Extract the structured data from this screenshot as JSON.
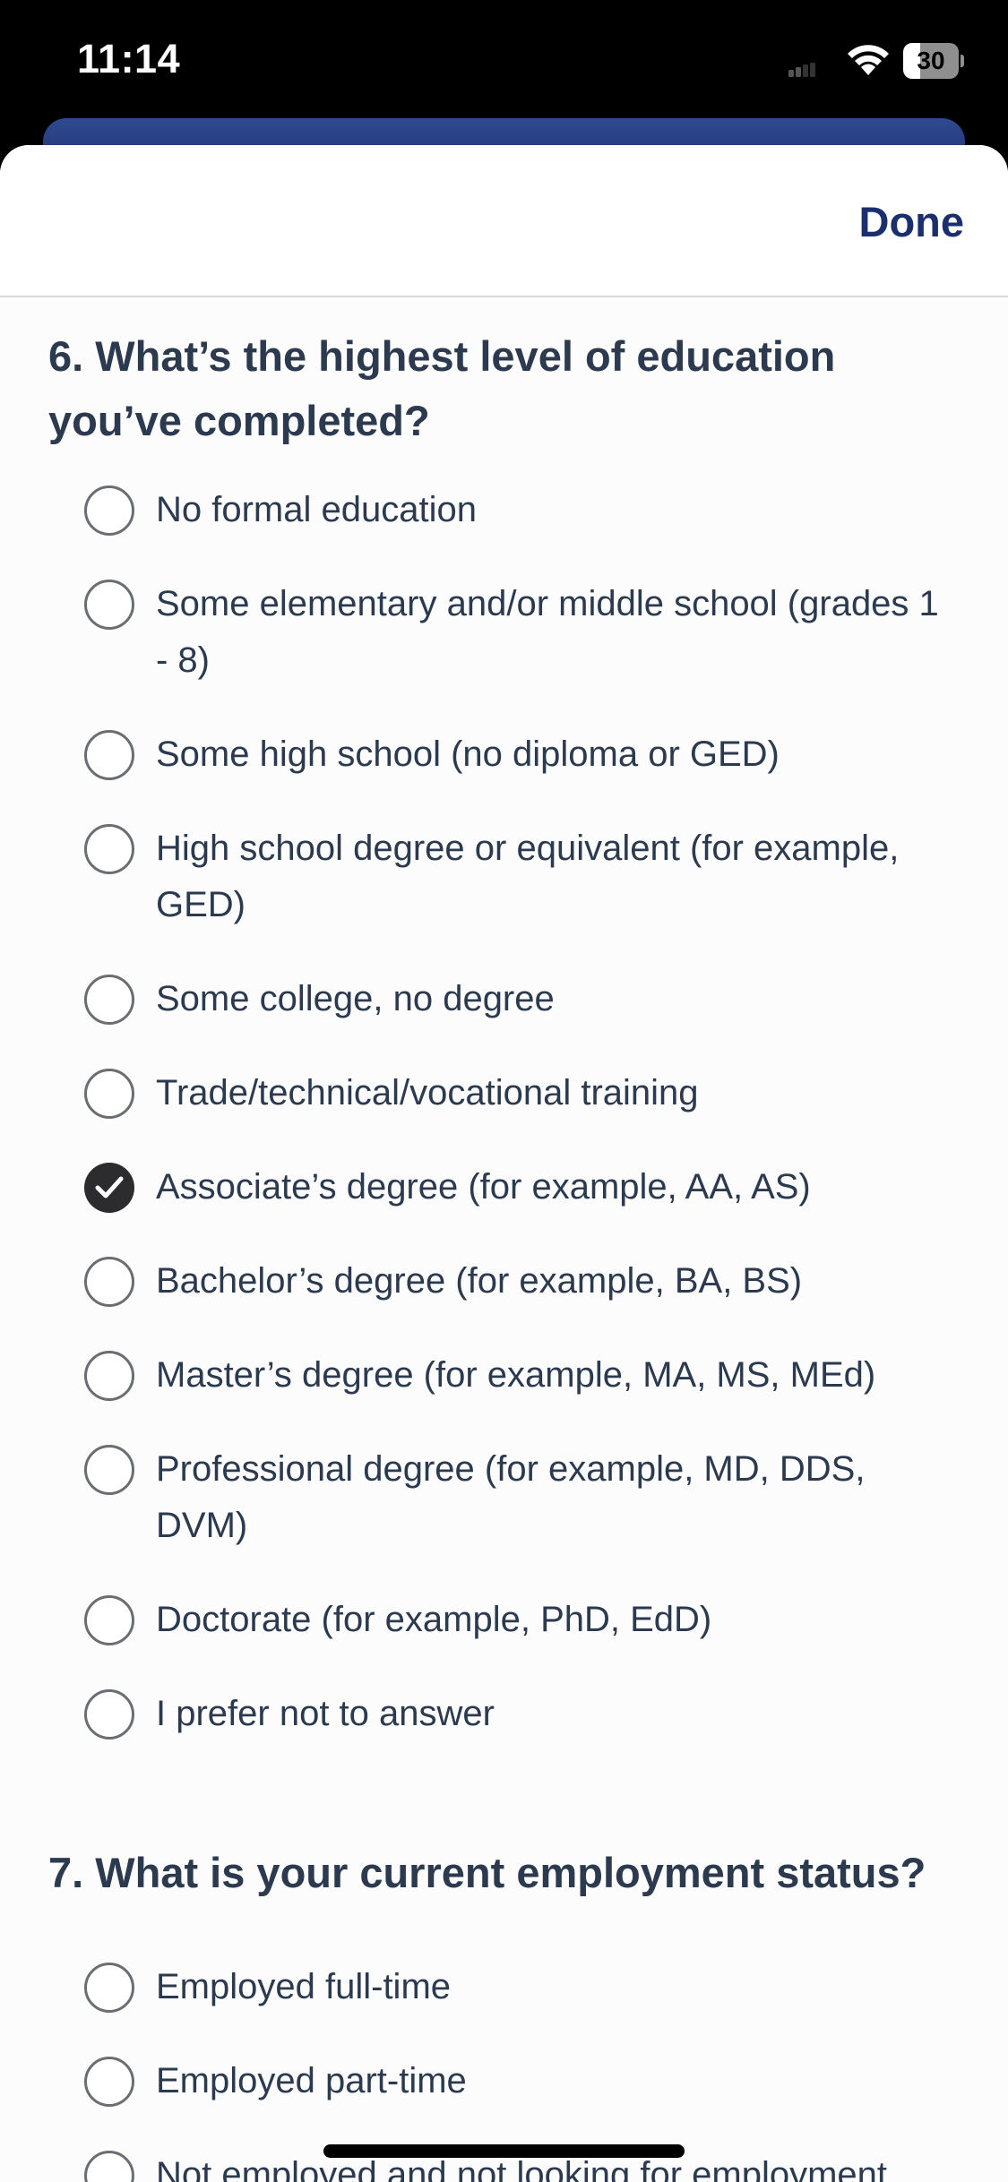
{
  "status_bar": {
    "time": "11:14",
    "battery_percent": "30",
    "battery_level": 0.3
  },
  "sheet": {
    "done_label": "Done"
  },
  "questions": [
    {
      "title": "6. What’s the highest level of education you’ve completed?",
      "options": [
        {
          "label": "No formal education",
          "checked": false
        },
        {
          "label": "Some elementary and/or middle school (grades 1 - 8)",
          "checked": false
        },
        {
          "label": "Some high school (no diploma or GED)",
          "checked": false
        },
        {
          "label": "High school degree or equivalent (for example, GED)",
          "checked": false
        },
        {
          "label": "Some college, no degree",
          "checked": false
        },
        {
          "label": "Trade/technical/vocational training",
          "checked": false
        },
        {
          "label": "Associate’s degree (for example, AA, AS)",
          "checked": true
        },
        {
          "label": "Bachelor’s degree (for example, BA, BS)",
          "checked": false
        },
        {
          "label": "Master’s degree (for example, MA, MS, MEd)",
          "checked": false
        },
        {
          "label": "Professional degree (for example, MD, DDS, DVM)",
          "checked": false
        },
        {
          "label": "Doctorate (for example, PhD, EdD)",
          "checked": false
        },
        {
          "label": "I prefer not to answer",
          "checked": false
        }
      ]
    },
    {
      "title": "7. What is your current employment status?",
      "options": [
        {
          "label": "Employed full-time",
          "checked": false
        },
        {
          "label": "Employed part-time",
          "checked": false
        },
        {
          "label": "Not employed and not looking for employment",
          "checked": false
        }
      ]
    }
  ]
}
